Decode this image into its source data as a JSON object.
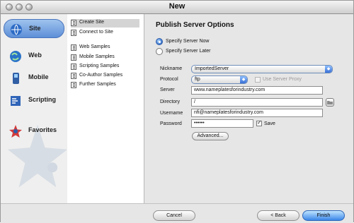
{
  "window": {
    "title": "New"
  },
  "categories": [
    {
      "label": "Site",
      "icon": "site-icon",
      "selected": true
    },
    {
      "label": "Web",
      "icon": "web-icon",
      "selected": false
    },
    {
      "label": "Mobile",
      "icon": "mobile-icon",
      "selected": false
    },
    {
      "label": "Scripting",
      "icon": "scripting-icon",
      "selected": false
    },
    {
      "label": "Favorites",
      "icon": "favorites-icon",
      "selected": false
    }
  ],
  "middle_list": [
    {
      "label": "Create Site",
      "selected": true
    },
    {
      "label": "Connect to Site",
      "selected": false
    },
    {
      "label": "Web Samples",
      "selected": false
    },
    {
      "label": "Mobile Samples",
      "selected": false
    },
    {
      "label": "Scripting Samples",
      "selected": false
    },
    {
      "label": "Co-Author Samples",
      "selected": false
    },
    {
      "label": "Further Samples",
      "selected": false
    }
  ],
  "panel": {
    "heading": "Publish Server Options",
    "radio_now": "Specify Server Now",
    "radio_later": "Specify Server Later",
    "selected_option": "Specify Server Now",
    "fields": {
      "nickname_label": "Nickname",
      "nickname_value": "ImportedServer",
      "protocol_label": "Protocol",
      "protocol_value": "ftp",
      "use_proxy_label": "Use Server Proxy",
      "server_label": "Server",
      "server_value": "www.nameplatesforindustry.com",
      "directory_label": "Directory",
      "directory_value": "/",
      "username_label": "Username",
      "username_value": "nfi@nameplatesforindustry.com",
      "password_label": "Password",
      "password_value": "••••••",
      "save_label": "Save"
    },
    "advanced_button": "Advanced..."
  },
  "buttons": {
    "cancel": "Cancel",
    "back": "< Back",
    "finish": "Finish"
  },
  "colors": {
    "selected_category": "#5d8fd7",
    "default_button": "#3b86e8"
  }
}
